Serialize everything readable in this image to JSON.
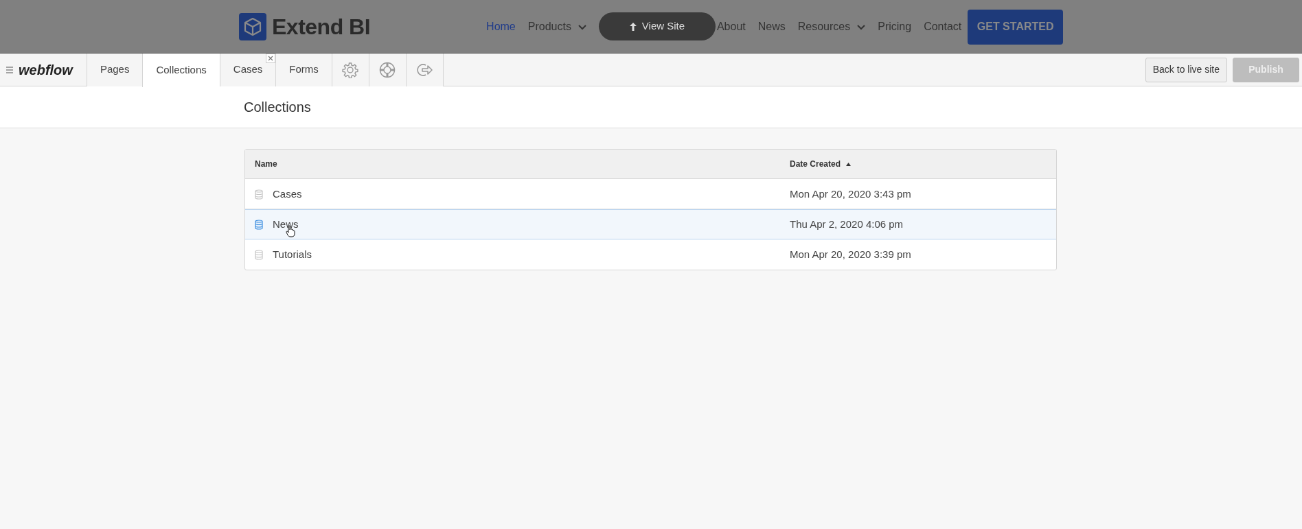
{
  "site_header": {
    "brand": "Extend BI",
    "nav": [
      {
        "label": "Home",
        "selected": true,
        "dropdown": false
      },
      {
        "label": "Products",
        "selected": false,
        "dropdown": true
      },
      {
        "label": "About",
        "selected": false,
        "dropdown": false
      },
      {
        "label": "News",
        "selected": false,
        "dropdown": false
      },
      {
        "label": "Resources",
        "selected": false,
        "dropdown": true
      },
      {
        "label": "Pricing",
        "selected": false,
        "dropdown": false
      },
      {
        "label": "Contact",
        "selected": false,
        "dropdown": false
      }
    ],
    "cta": "GET STARTED",
    "view_site": "View Site"
  },
  "toolbar": {
    "logo": "webflow",
    "tabs": [
      {
        "kind": "text",
        "label": "Pages",
        "selected": false,
        "closable": false
      },
      {
        "kind": "text",
        "label": "Collections",
        "selected": true,
        "closable": false
      },
      {
        "kind": "text",
        "label": "Cases",
        "selected": false,
        "closable": true
      },
      {
        "kind": "text",
        "label": "Forms",
        "selected": false,
        "closable": false
      },
      {
        "kind": "icon",
        "selected": false,
        "closable": false
      },
      {
        "kind": "icon",
        "selected": false,
        "closable": false
      },
      {
        "kind": "icon",
        "selected": false,
        "closable": false
      }
    ],
    "buttons": [
      {
        "label": "Back to live site",
        "disabled": false
      },
      {
        "label": "Publish",
        "disabled": true
      }
    ]
  },
  "page_title": "Collections",
  "table": {
    "columns": [
      {
        "label": "Name",
        "sorted": false
      },
      {
        "label": "Date Created",
        "sorted": true
      }
    ],
    "rows": [
      {
        "name": "Cases",
        "date": "Mon Apr 20, 2020 3:43 pm",
        "selected": false
      },
      {
        "name": "News",
        "date": "Thu Apr 2, 2020 4:06 pm",
        "selected": true
      },
      {
        "name": "Tutorials",
        "date": "Mon Apr 20, 2020 3:39 pm",
        "selected": false
      }
    ]
  }
}
